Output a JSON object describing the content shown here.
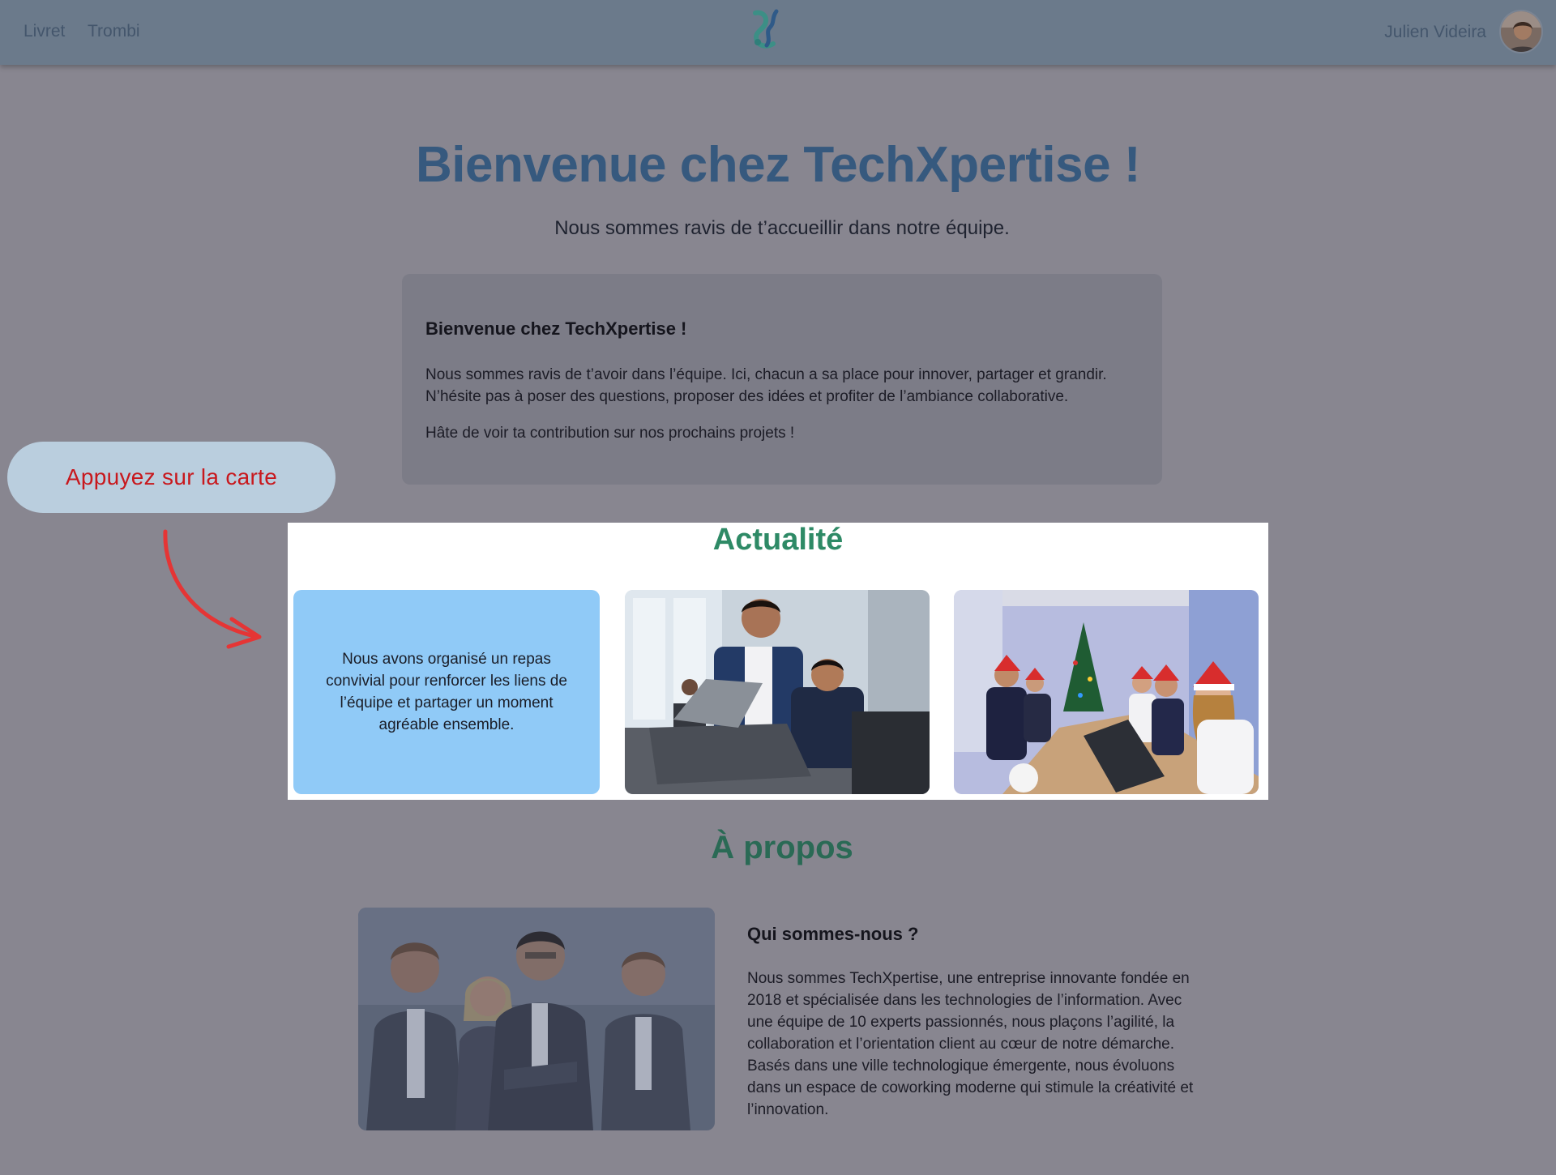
{
  "nav": {
    "links": [
      "Livret",
      "Trombi"
    ],
    "logo_icon": "techxpertise-logo-icon",
    "user_name": "Julien Videira"
  },
  "hero": {
    "title": "Bienvenue chez TechXpertise !",
    "subtitle": "Nous sommes ravis de t’accueillir dans notre équipe."
  },
  "welcome_card": {
    "title": "Bienvenue chez TechXpertise !",
    "paragraph1": "Nous sommes ravis de t’avoir dans l’équipe. Ici, chacun a sa place pour innover, partager et grandir. N’hésite pas à poser des questions, proposer des idées et profiter de l’ambiance collaborative.",
    "paragraph2": "Hâte de voir ta contribution sur nos prochains projets !"
  },
  "hint": {
    "text": "Appuyez sur la carte",
    "color": "#c8181d"
  },
  "news": {
    "title": "Actualité",
    "card_text": "Nous avons organisé un repas convivial pour renforcer les liens de l’équipe et partager un moment agréable ensemble.",
    "title_color": "#2e8a66",
    "card_color": "#90caf7"
  },
  "about": {
    "title": "À propos",
    "subtitle": "Qui sommes-nous ?",
    "text": "Nous sommes TechXpertise, une entreprise innovante fondée en 2018 et spécialisée dans les technologies de l’information. Avec une équipe de 10 experts passionnés, nous plaçons l’agilité, la collaboration et l’orientation client au cœur de notre démarche. Basés dans une ville technologique émergente, nous évoluons dans un espace de coworking moderne qui stimule la créativité et l’innovation."
  },
  "colors": {
    "navbar": "#6b7a8b",
    "overlay_background": "#888690",
    "hero_title": "#36597e"
  }
}
